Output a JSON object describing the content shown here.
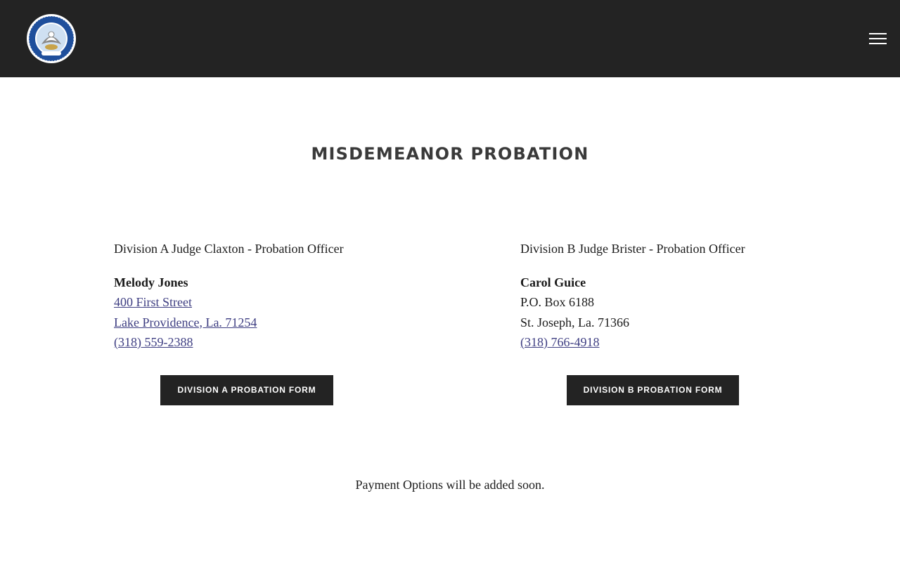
{
  "header": {
    "logo_icon": "louisiana-state-seal",
    "menu_icon": "hamburger-menu-icon",
    "background": "#232323"
  },
  "page": {
    "title": "MISDEMEANOR PROBATION"
  },
  "division_a": {
    "heading": "Division A Judge Claxton - Probation Officer",
    "name": "Melody Jones",
    "address_line1": "400 First Street",
    "address_line2": "Lake Providence, La. 71254",
    "phone": "(318) 559-2388",
    "button_label": "DIVISION A PROBATION FORM"
  },
  "division_b": {
    "heading": "Division B Judge Brister - Probation Officer",
    "name": "Carol Guice",
    "address_line1": "P.O. Box 6188",
    "address_line2": "St. Joseph, La. 71366",
    "phone": "(318) 766-4918",
    "button_label": "DIVISION B PROBATION FORM"
  },
  "footer_note": "Payment Options will be added soon.",
  "colors": {
    "link": "#3e3e82",
    "button_bg": "#232323",
    "title": "#3a3a3a"
  }
}
